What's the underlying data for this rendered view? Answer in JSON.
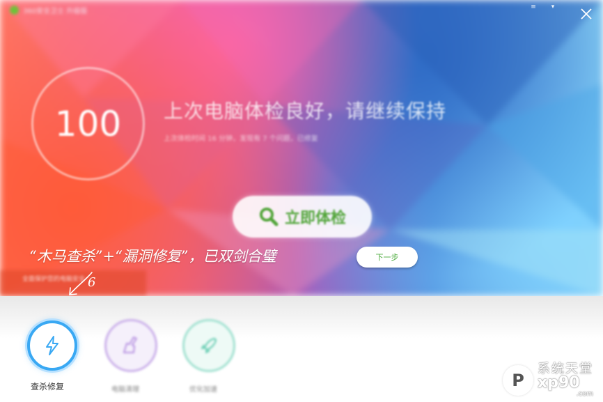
{
  "window": {
    "title": "360安全卫士 升级版",
    "close_label": "×",
    "minimize_label": "▾",
    "menu_label": "≡"
  },
  "hero": {
    "score": "100",
    "headline": "上次电脑体检良好，请继续保持",
    "subline": "上次体检时间 16 分钟，发现有 7 个问题，已修复",
    "check_button": "立即体检",
    "banner_text": "全面保护您的电脑安全"
  },
  "tutorial": {
    "tip": "“木马查杀”+“漏洞修复”，已双剑合璧",
    "step_number": "6",
    "next_button": "下一步"
  },
  "features": [
    {
      "label": "查杀修复",
      "icon": "lightning-icon",
      "color": "#39a8f3"
    },
    {
      "label": "电脑清理",
      "icon": "broom-icon",
      "color": "#b48ee0"
    },
    {
      "label": "优化加速",
      "icon": "rocket-icon",
      "color": "#5cc9ad"
    }
  ],
  "watermark": {
    "mark": "P",
    "cn": "系统天堂",
    "en": "xp90",
    "com": ".com"
  }
}
